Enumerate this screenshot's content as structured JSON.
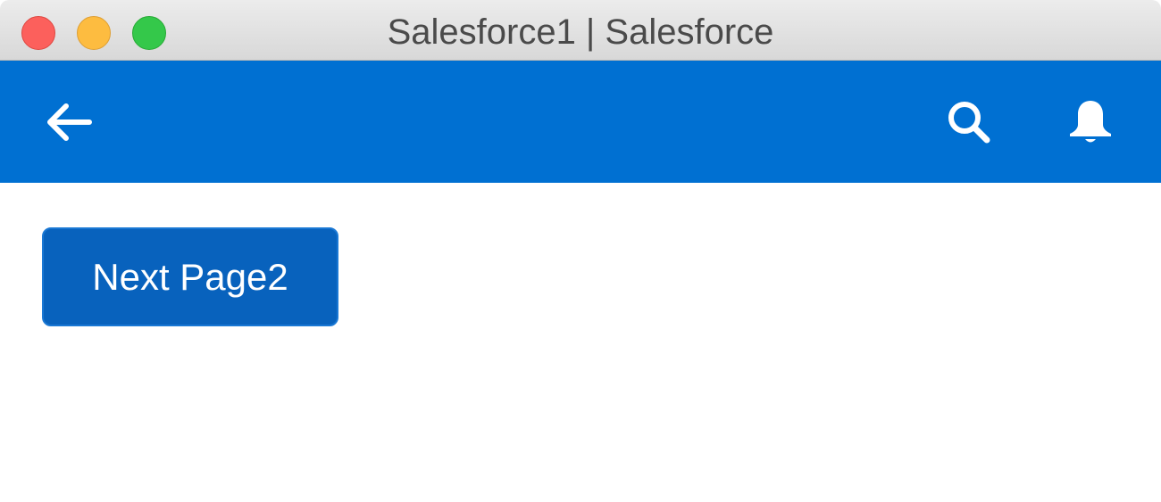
{
  "window": {
    "title": "Salesforce1 | Salesforce"
  },
  "navbar": {
    "background_color": "#0070d2",
    "back_icon": "arrow-left-icon",
    "search_icon": "search-icon",
    "notifications_icon": "bell-icon"
  },
  "content": {
    "next_button_label": "Next Page2",
    "button_color": "#0862bd"
  }
}
